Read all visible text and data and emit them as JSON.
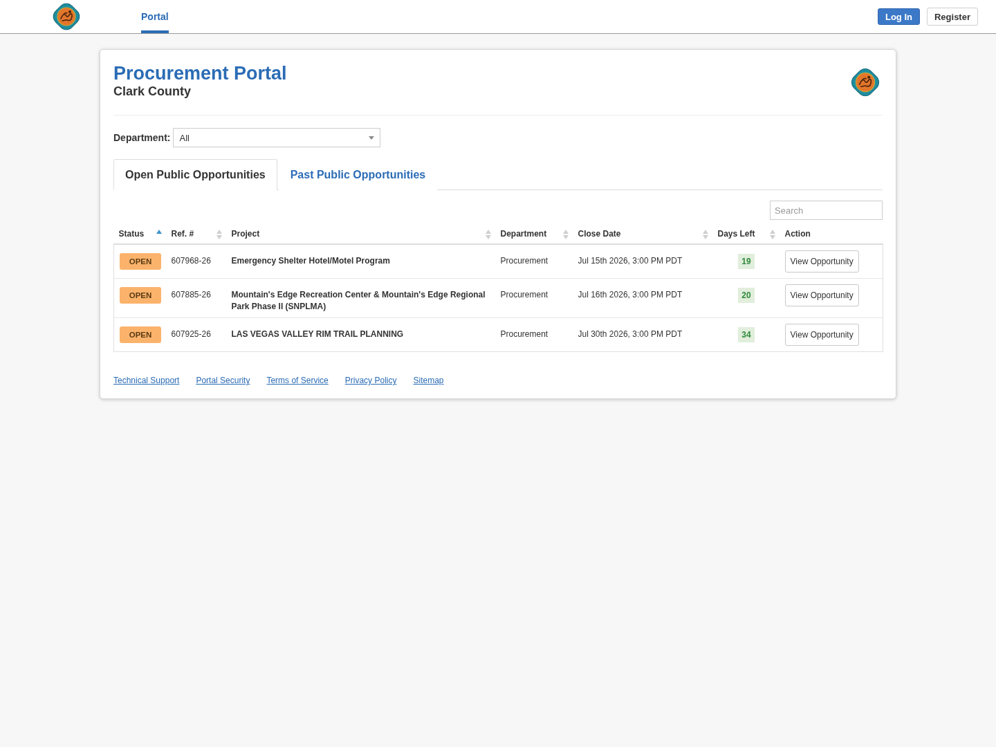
{
  "top_nav": {
    "items": [
      {
        "label": "Portal",
        "selected": true
      }
    ],
    "buttons": [
      {
        "label": "Log In",
        "kind": "primary"
      },
      {
        "label": "Register",
        "kind": "default"
      }
    ]
  },
  "header": {
    "title": "Procurement Portal",
    "subtitle": "Clark County"
  },
  "department_filter": {
    "label": "Department:",
    "value": "All"
  },
  "tabs": [
    {
      "label": "Open Public Opportunities",
      "selected": true
    },
    {
      "label": "Past Public Opportunities",
      "selected": false
    }
  ],
  "search": {
    "placeholder": "Search"
  },
  "table": {
    "columns": [
      {
        "label": "Status",
        "sortable": true,
        "sorted": true
      },
      {
        "label": "Ref. #",
        "sortable": true,
        "sorted": false
      },
      {
        "label": "Project",
        "sortable": true,
        "sorted": false
      },
      {
        "label": "Department",
        "sortable": true,
        "sorted": false
      },
      {
        "label": "Close Date",
        "sortable": true,
        "sorted": false
      },
      {
        "label": "Days Left",
        "sortable": true,
        "sorted": false
      },
      {
        "label": "Action",
        "sortable": false
      }
    ],
    "rows": [
      {
        "status": "OPEN",
        "ref": "607968-26",
        "project": "Emergency Shelter Hotel/Motel Program",
        "department": "Procurement",
        "close_date": "Jul 15th 2026, 3:00 PM PDT",
        "days_left": "19",
        "action": "View Opportunity"
      },
      {
        "status": "OPEN",
        "ref": "607885-26",
        "project": "Mountain's Edge Recreation Center & Mountain's Edge Regional Park Phase II (SNPLMA)",
        "department": "Procurement",
        "close_date": "Jul 16th 2026, 3:00 PM PDT",
        "days_left": "20",
        "action": "View Opportunity"
      },
      {
        "status": "OPEN",
        "ref": "607925-26",
        "project": "LAS VEGAS VALLEY RIM TRAIL PLANNING",
        "department": "Procurement",
        "close_date": "Jul 30th 2026, 3:00 PM PDT",
        "days_left": "34",
        "action": "View Opportunity"
      }
    ]
  },
  "footer_links": [
    "Technical Support",
    "Portal Security",
    "Terms of Service",
    "Privacy Policy",
    "Sitemap"
  ]
}
